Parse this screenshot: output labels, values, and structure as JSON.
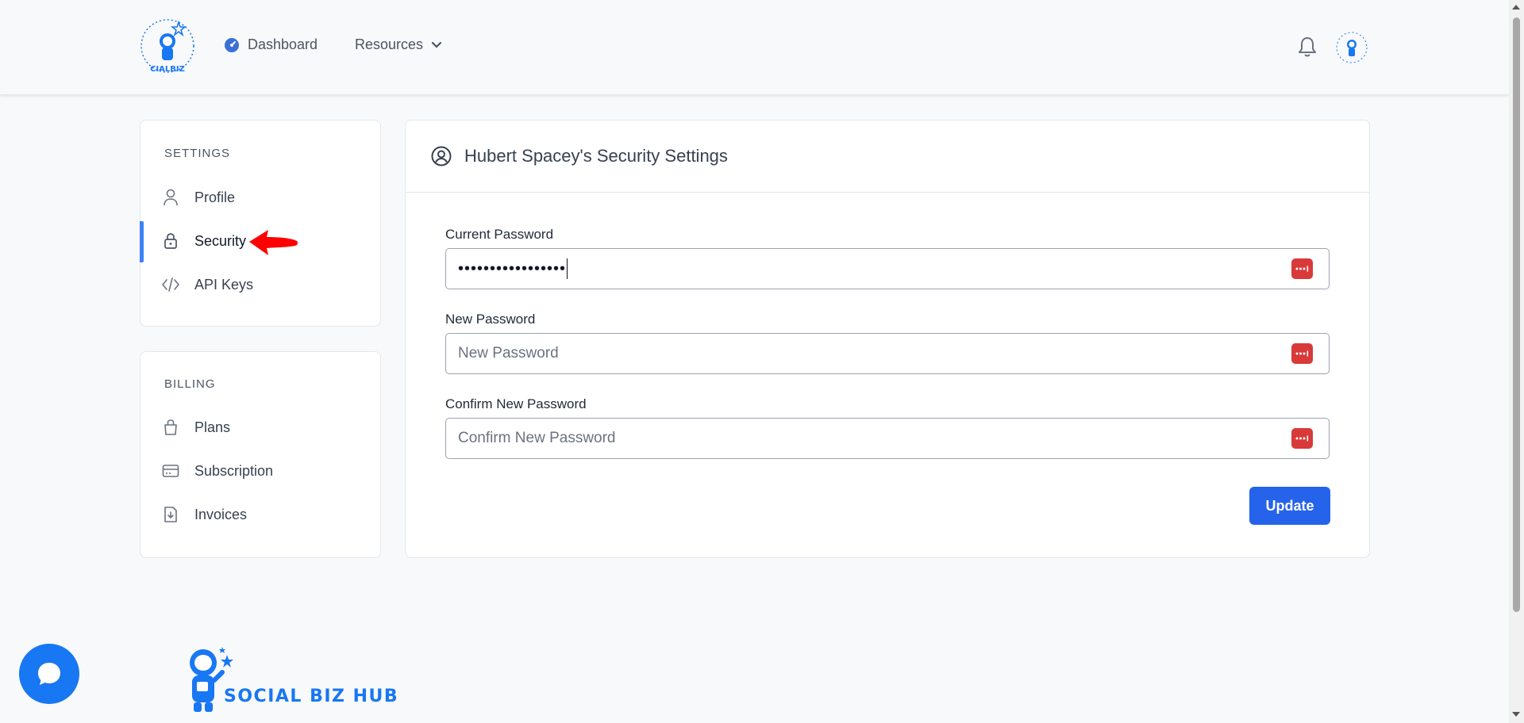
{
  "header": {
    "nav": [
      {
        "label": "Dashboard",
        "icon": "dashboard-gauge-icon"
      },
      {
        "label": "Resources",
        "icon": "chevron-down-icon"
      }
    ],
    "logo_text": "SOCIAL BIZ HUB"
  },
  "sidebar": {
    "settings": {
      "heading": "SETTINGS",
      "items": [
        {
          "label": "Profile",
          "icon": "user-icon"
        },
        {
          "label": "Security",
          "icon": "lock-icon",
          "active": true
        },
        {
          "label": "API Keys",
          "icon": "code-icon"
        }
      ]
    },
    "billing": {
      "heading": "BILLING",
      "items": [
        {
          "label": "Plans",
          "icon": "shopping-bag-icon"
        },
        {
          "label": "Subscription",
          "icon": "credit-card-icon"
        },
        {
          "label": "Invoices",
          "icon": "file-download-icon"
        }
      ]
    }
  },
  "main": {
    "title": "Hubert Spacey's Security Settings",
    "fields": [
      {
        "label": "Current Password",
        "value": "•••••••••••••••••",
        "placeholder": ""
      },
      {
        "label": "New Password",
        "value": "",
        "placeholder": "New Password"
      },
      {
        "label": "Confirm New Password",
        "value": "",
        "placeholder": "Confirm New Password"
      }
    ],
    "update_label": "Update"
  },
  "footer": {
    "brand": "SOCIAL BIZ HUB"
  },
  "colors": {
    "accent": "#2563eb",
    "active_indicator": "#3b82f6",
    "password_badge": "#d83a3a",
    "brand_blue": "#1877f2",
    "annotation_arrow": "#ff0000"
  }
}
